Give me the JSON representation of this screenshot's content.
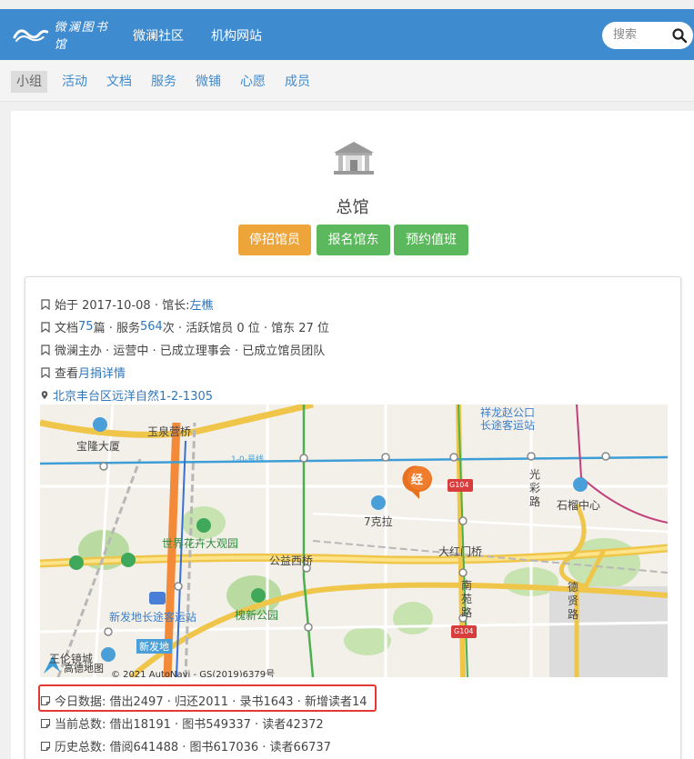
{
  "header": {
    "logo_text": "微澜图书馆",
    "nav": [
      {
        "label": "微澜社区"
      },
      {
        "label": "机构网站"
      }
    ],
    "search_placeholder": "搜索"
  },
  "subnav": [
    {
      "label": "小组",
      "active": true
    },
    {
      "label": "活动"
    },
    {
      "label": "文档"
    },
    {
      "label": "服务"
    },
    {
      "label": "微铺"
    },
    {
      "label": "心愿"
    },
    {
      "label": "成员"
    }
  ],
  "branch": {
    "title": "总馆",
    "buttons": [
      {
        "label": "停招馆员"
      },
      {
        "label": "报名馆东"
      },
      {
        "label": "预约值班"
      }
    ]
  },
  "info": {
    "l1_prefix": "始于 2017-10-08 · 馆长: ",
    "l1_link": "左樵",
    "l2_a": "文档 ",
    "l2_docs": "75",
    "l2_b": " 篇 · 服务 ",
    "l2_services": "564",
    "l2_c": " 次 · 活跃馆员 0 位 · 馆东 27 位",
    "l3": "微澜主办 · 运营中 · 已成立理事会 · 已成立馆员团队",
    "l4_prefix": "查看",
    "l4_link": "月捐详情",
    "address": "北京丰台区远洋自然1-2-1305"
  },
  "map": {
    "labels": {
      "baolong": "宝隆大厦",
      "yuquanying": "玉泉营桥",
      "line10": "1-0-号线",
      "xianglong": "祥龙赵公口",
      "changtu": "长途客运站",
      "guang": "光",
      "cai": "彩",
      "lu": "路",
      "shiliu": "石榴中心",
      "jing": "经",
      "g104a": "G104",
      "qike": "7克拉",
      "huahui": "世界花卉大观园",
      "gongyi": "公益西桥",
      "dahong": "大红门桥",
      "nan": "南",
      "yuan": "苑",
      "lu2": "路",
      "de": "德",
      "xian": "贤",
      "lu3": "路",
      "xinfadi": "新发地长途客运站",
      "huaixin": "槐新公园",
      "g104b": "G104",
      "xinfa2": "新发地",
      "yujin": "王伦镜城",
      "gaode": "高德地图",
      "copyright": "© 2021 AutoNavi - GS(2019)6379号"
    }
  },
  "stats": {
    "today": "今日数据: 借出2497 · 归还2011 · 录书1643 · 新增读者14",
    "current": "当前总数: 借出18191 · 图书549337 · 读者42372",
    "history": "历史总数: 借阅641488 · 图书617036 · 读者66737"
  },
  "colors": {
    "header": "#3f8bd0",
    "orange": "#eda53a",
    "green": "#5cb85c",
    "link": "#2e76bb",
    "highlight": "#e53935"
  }
}
